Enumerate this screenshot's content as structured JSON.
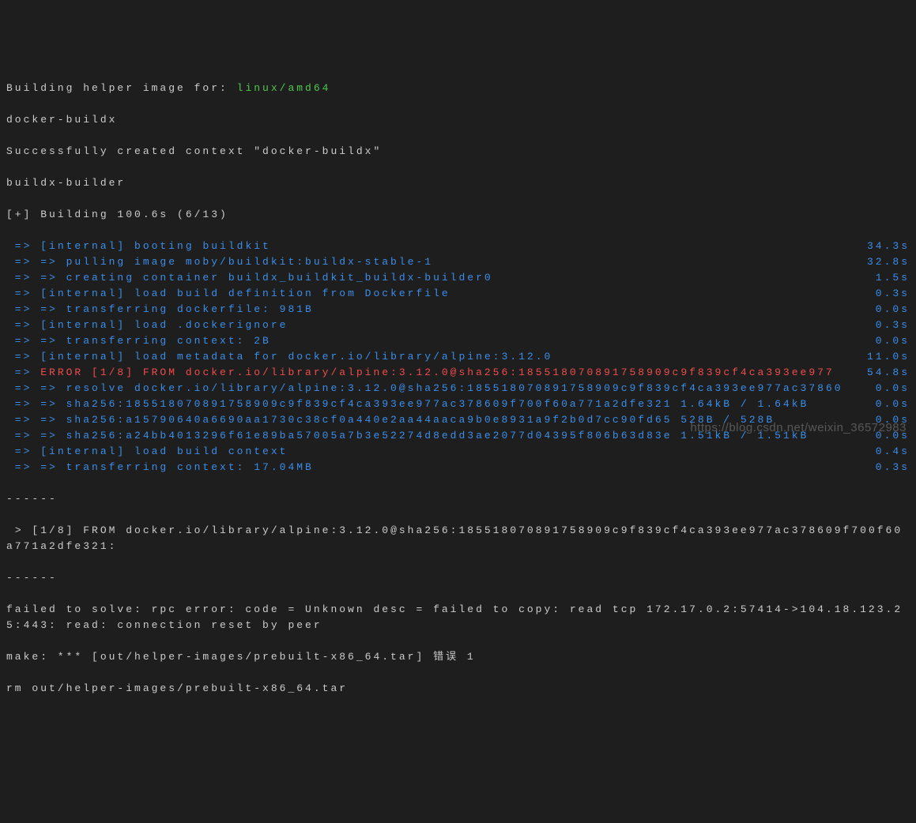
{
  "header": {
    "line1_prefix": "Building helper image for: ",
    "line1_arch": "linux/amd64",
    "line2": "docker-buildx",
    "line3": "Successfully created context \"docker-buildx\"",
    "line4": "buildx-builder",
    "line5": "[+] Building 100.6s (6/13)"
  },
  "steps": [
    {
      "arrow": " => ",
      "text": "[internal] booting buildkit",
      "time": "34.3s",
      "color": "blue"
    },
    {
      "arrow": " => => ",
      "text": "pulling image moby/buildkit:buildx-stable-1",
      "time": "32.8s",
      "color": "blue"
    },
    {
      "arrow": " => => ",
      "text": "creating container buildx_buildkit_buildx-builder0",
      "time": "1.5s",
      "color": "blue"
    },
    {
      "arrow": " => ",
      "text": "[internal] load build definition from Dockerfile",
      "time": "0.3s",
      "color": "blue"
    },
    {
      "arrow": " => => ",
      "text": "transferring dockerfile: 981B",
      "time": "0.0s",
      "color": "blue"
    },
    {
      "arrow": " => ",
      "text": "[internal] load .dockerignore",
      "time": "0.3s",
      "color": "blue"
    },
    {
      "arrow": " => => ",
      "text": "transferring context: 2B",
      "time": "0.0s",
      "color": "blue"
    },
    {
      "arrow": " => ",
      "text": "[internal] load metadata for docker.io/library/alpine:3.12.0",
      "time": "11.0s",
      "color": "blue"
    },
    {
      "arrow": " => ",
      "text": "ERROR [1/8] FROM docker.io/library/alpine:3.12.0@sha256:185518070891758909c9f839cf4ca393ee977",
      "time": "54.8s",
      "color": "red"
    },
    {
      "arrow": " => => ",
      "text": "resolve docker.io/library/alpine:3.12.0@sha256:185518070891758909c9f839cf4ca393ee977ac37860",
      "time": "0.0s",
      "color": "blue"
    },
    {
      "arrow": " => => ",
      "text": "sha256:185518070891758909c9f839cf4ca393ee977ac378609f700f60a771a2dfe321 1.64kB / 1.64kB",
      "time": "0.0s",
      "color": "blue"
    },
    {
      "arrow": " => => ",
      "text": "sha256:a15790640a6690aa1730c38cf0a440e2aa44aaca9b0e8931a9f2b0d7cc90fd65 528B / 528B",
      "time": "0.0s",
      "color": "blue"
    },
    {
      "arrow": " => => ",
      "text": "sha256:a24bb4013296f61e89ba57005a7b3e52274d8edd3ae2077d04395f806b63d83e 1.51kB / 1.51kB",
      "time": "0.0s",
      "color": "blue"
    },
    {
      "arrow": " => ",
      "text": "[internal] load build context",
      "time": "0.4s",
      "color": "blue"
    },
    {
      "arrow": " => => ",
      "text": "transferring context: 17.04MB",
      "time": "0.3s",
      "color": "blue"
    }
  ],
  "footer": {
    "sep": "------",
    "error_from": " > [1/8] FROM docker.io/library/alpine:3.12.0@sha256:185518070891758909c9f839cf4ca393ee977ac378609f700f60a771a2dfe321:",
    "sep2": "------",
    "failed": "failed to solve: rpc error: code = Unknown desc = failed to copy: read tcp 172.17.0.2:57414->104.18.123.25:443: read: connection reset by peer",
    "make": "make: *** [out/helper-images/prebuilt-x86_64.tar] 错误 1",
    "rm": "rm out/helper-images/prebuilt-x86_64.tar"
  },
  "watermark": "https://blog.csdn.net/weixin_36572983"
}
